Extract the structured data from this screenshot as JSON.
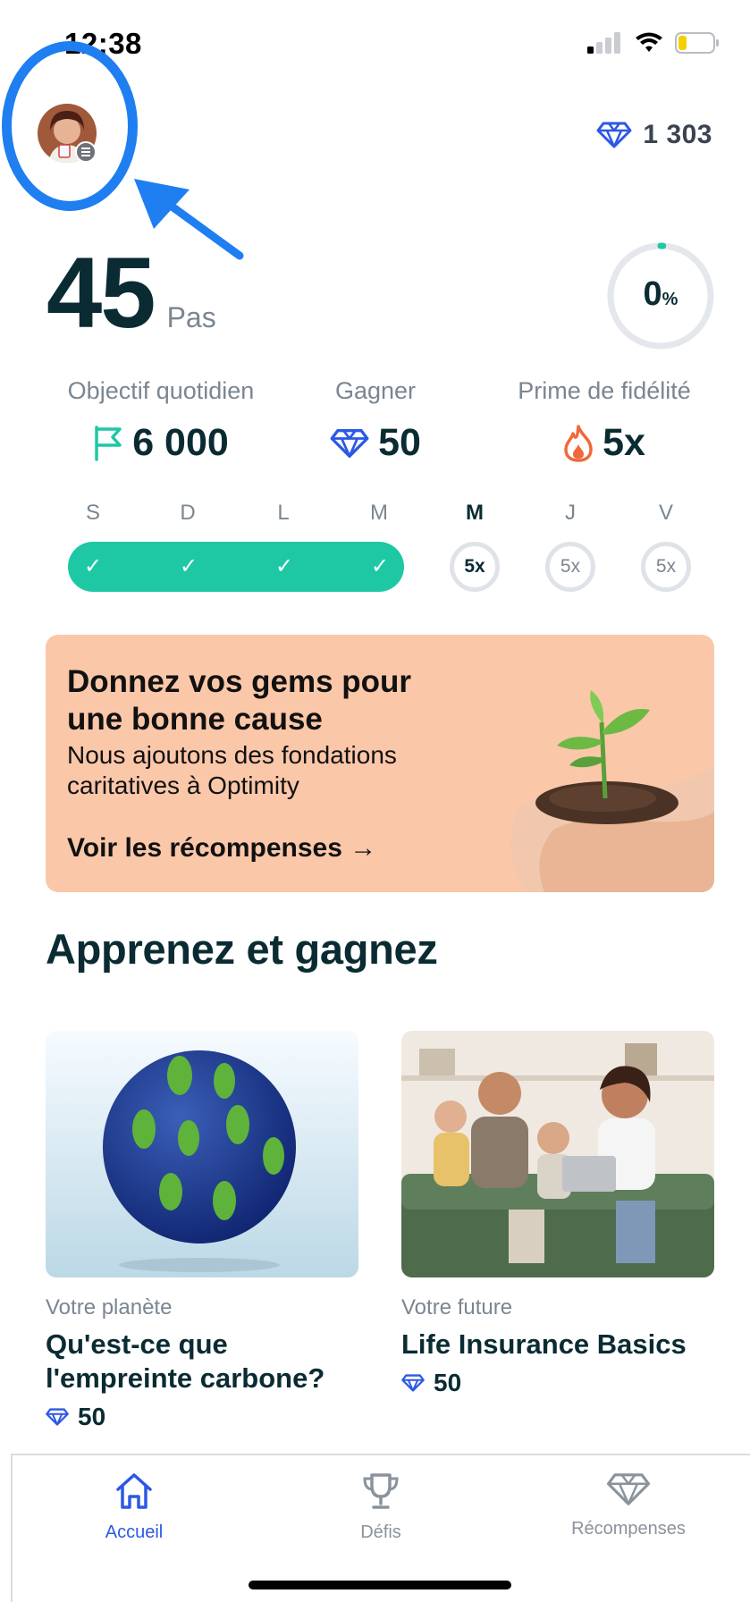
{
  "status_bar": {
    "time": "12:38"
  },
  "header": {
    "gems_balance": "1 303"
  },
  "steps": {
    "count": "45",
    "unit": "Pas"
  },
  "progress": {
    "value": "0",
    "suffix": "%"
  },
  "stats": [
    {
      "label": "Objectif quotidien",
      "value": "6 000",
      "icon": "flag-icon"
    },
    {
      "label": "Gagner",
      "value": "50",
      "icon": "gem-icon"
    },
    {
      "label": "Prime de fidélité",
      "value": "5x",
      "icon": "flame-icon"
    }
  ],
  "week": {
    "days": [
      "S",
      "D",
      "L",
      "M",
      "M",
      "J",
      "V"
    ],
    "today_index": 4,
    "completed_days": 4,
    "multipliers": [
      "5x",
      "5x",
      "5x"
    ]
  },
  "promo": {
    "title": "Donnez vos gems pour une bonne cause",
    "subtitle": "Nous ajoutons des fondations caritatives à Optimity",
    "link": "Voir les récompenses →"
  },
  "learn": {
    "title": "Apprenez et gagnez",
    "cards": [
      {
        "category": "Votre planète",
        "title": "Qu'est-ce que l'empreinte carbone?",
        "gems": "50"
      },
      {
        "category": "Votre future",
        "title": "Life Insurance Basics",
        "gems": "50"
      }
    ]
  },
  "tabbar": {
    "tabs": [
      {
        "label": "Accueil",
        "icon": "home-icon",
        "active": true
      },
      {
        "label": "Défis",
        "icon": "trophy-icon",
        "active": false
      },
      {
        "label": "Récompenses",
        "icon": "gem-icon",
        "active": false
      }
    ]
  },
  "colors": {
    "accent": "#2c58e6",
    "streak": "#1ec8a5",
    "promo_bg": "#fbc7a9",
    "annotation": "#1f7ef0"
  }
}
